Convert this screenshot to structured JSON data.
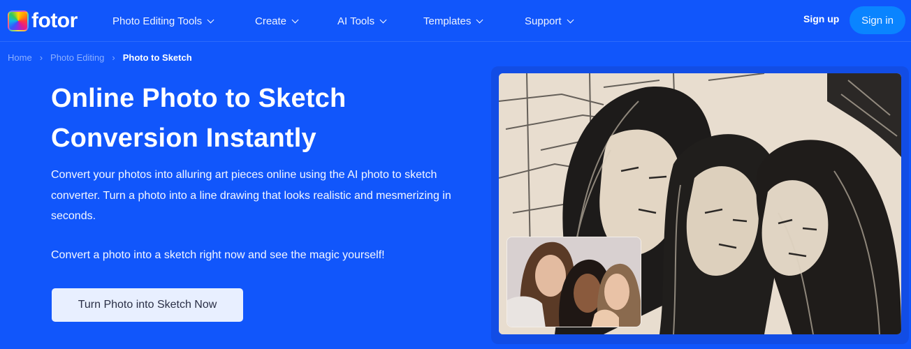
{
  "header": {
    "logo_text": "fotor",
    "logo_icon": "fotor-rainbow-logo-icon",
    "nav": [
      {
        "label": "Photo Editing Tools",
        "icon": "chevron-down-icon"
      },
      {
        "label": "Create",
        "icon": "chevron-down-icon"
      },
      {
        "label": "AI Tools",
        "icon": "chevron-down-icon"
      },
      {
        "label": "Templates",
        "icon": "chevron-down-icon"
      },
      {
        "label": "Support",
        "icon": "chevron-down-icon"
      }
    ],
    "sign_up_label": "Sign up",
    "sign_in_label": "Sign in"
  },
  "breadcrumb": {
    "items": [
      "Home",
      "Photo Editing",
      "Photo to Sketch"
    ],
    "separator_icon": "chevron-right-icon"
  },
  "hero": {
    "title_line1": "Online Photo to Sketch",
    "title_line2": "Conversion Instantly",
    "description": "Convert your photos into alluring art pieces online using the AI photo to sketch converter. Turn a photo into a line drawing that looks realistic and mesmerizing in seconds.",
    "description2": "Convert a photo into a sketch right now and see the magic yourself!",
    "cta_label": "Turn Photo into Sketch Now"
  },
  "images": {
    "sketch_alt": "Sketch-style drawing of three women leaning their heads together",
    "original_alt": "Original photo of three women leaning their heads together"
  },
  "colors": {
    "background": "#1156fb",
    "sign_in_button": "#0a84ff",
    "cta_button": "#e8efff",
    "breadcrumb_inactive": "#8db0ff"
  }
}
